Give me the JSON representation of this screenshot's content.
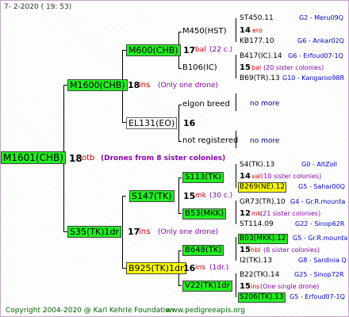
{
  "header": {
    "date": "7-  2-2020 ( 19: 53)"
  },
  "footer": {
    "copyright": "Copyright 2004-2020 @ Karl Kehrle Foundation",
    "site": "www.pedigreeapis.org"
  },
  "root": {
    "label": "M1601(CHB)",
    "num": "18",
    "code": "otb",
    "note": "(Drones from 8 sister colonies)"
  },
  "gen1": [
    {
      "label": "M1600(CHB)",
      "num": "18",
      "code": "ins",
      "note": "(Only one drone)"
    },
    {
      "label": "S35(TK)1dr",
      "num": "17",
      "code": "ins",
      "note": "(Only one drone)"
    }
  ],
  "gen2": [
    {
      "label": "M600(CHB)",
      "num": "17",
      "code": "bal",
      "note": "(22 c.)"
    },
    {
      "label": "EL131(EO)",
      "num": "16"
    },
    {
      "label": "S147(TK)",
      "num": "15",
      "code": "mk",
      "note": "(30 c.)"
    },
    {
      "label": "B925(TK)1dr",
      "num": "16",
      "code": "ins",
      "note": "(1dr.)"
    }
  ],
  "gen3": [
    {
      "label": "M450(HST)"
    },
    {
      "label": "B106(IC)"
    },
    {
      "label": "elgon breed"
    },
    {
      "label": "not registered"
    },
    {
      "label": "S113(TK)"
    },
    {
      "label": "B53(MKK)"
    },
    {
      "label": "B648(TK)"
    },
    {
      "label": "V22(TK)1dr"
    }
  ],
  "gen4": [
    {
      "label": "ST450.11",
      "ref": "G2 - Meru09Q"
    },
    {
      "label": "14",
      "code": "ero"
    },
    {
      "label": "KB177.10",
      "ref": "G6 - Ankar02Q"
    },
    {
      "label": "B417(IC).14",
      "ref": "G6 - Erfoud07-1Q"
    },
    {
      "label": "15",
      "code": "bal",
      "note": "(20 sister colonies)"
    },
    {
      "label": "B69(TR).13",
      "ref": "G10 - Kangaroo98R"
    },
    {
      "label": "no more"
    },
    {
      "label": "no more"
    },
    {
      "label": "S4(TK).13",
      "ref": "G0 - AltZoll"
    },
    {
      "label": "14",
      "code": "val",
      "note": "(10 sister colonies)"
    },
    {
      "label": "B269(NE).12",
      "ref": "G5 - Sahar00Q"
    },
    {
      "label": "GR73(TR).10",
      "ref": "G4 - Gr.R.mounta"
    },
    {
      "label": "12",
      "code": "mk",
      "note": "(21 sister colonies)"
    },
    {
      "label": "ST114.09",
      "ref": "G22 - Sinop62R"
    },
    {
      "label": "B03(MKK).12",
      "ref": "G5 - Gr.R.mounta"
    },
    {
      "label": "15",
      "code": "hbl",
      "note": "(8 sister colonies)"
    },
    {
      "label": "I2(TK).13",
      "ref": "G8 - Sardinia Q"
    },
    {
      "label": "B22(TK).14",
      "ref": "G25 - Sinop72R"
    },
    {
      "label": "15",
      "code": "ins",
      "note": "(One single drone)"
    },
    {
      "label": "S206(TK).13",
      "ref": "G5 - Erfoud07-1Q"
    }
  ]
}
